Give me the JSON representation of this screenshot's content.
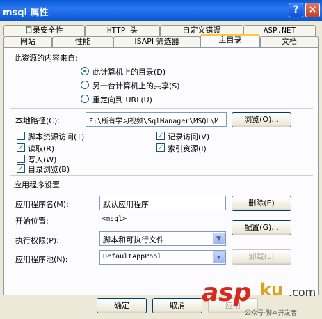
{
  "window": {
    "title": "msql 属性",
    "help": "?",
    "close": "×"
  },
  "tabs_back": [
    "目录安全性",
    "HTTP 头",
    "自定义错误",
    "ASP.NET"
  ],
  "tabs_front": [
    "网站",
    "性能",
    "ISAPI 筛选器",
    "主目录",
    "文档"
  ],
  "content_source": {
    "label": "此资源的内容来自:",
    "options": [
      "此计算机上的目录(D)",
      "另一台计算机上的共享(S)",
      "重定向到 URL(U)"
    ],
    "selected": 0
  },
  "local_path": {
    "label": "本地路径(C):",
    "value": "F:\\所有学习视频\\SqlManager\\MSQL\\M",
    "browse": "浏览(O)..."
  },
  "checkboxes_left": [
    {
      "label": "脚本资源访问(T)",
      "checked": false
    },
    {
      "label": "读取(R)",
      "checked": true
    },
    {
      "label": "写入(W)",
      "checked": false
    },
    {
      "label": "目录浏览(B)",
      "checked": true
    }
  ],
  "checkboxes_right": [
    {
      "label": "记录访问(V)",
      "checked": true
    },
    {
      "label": "索引资源(I)",
      "checked": true
    }
  ],
  "app_settings": {
    "heading": "应用程序设置",
    "name_label": "应用程序名(M):",
    "name_value": "默认应用程序",
    "remove": "删除(E)",
    "start_label": "开始位置:",
    "start_value": "<msql>",
    "config": "配置(G)...",
    "exec_label": "执行权限(P):",
    "exec_value": "脚本和可执行文件",
    "pool_label": "应用程序池(N):",
    "pool_value": "DefaultAppPool",
    "unload": "卸载(L)"
  },
  "footer": {
    "ok": "确定",
    "cancel": "取消",
    "apply": "应用"
  },
  "watermark": {
    "brand": "asp",
    "ku": "ku",
    "site": ".com",
    "sub": "公众号·脚本开发者"
  },
  "checkmark": "✓",
  "arrow": "▼"
}
